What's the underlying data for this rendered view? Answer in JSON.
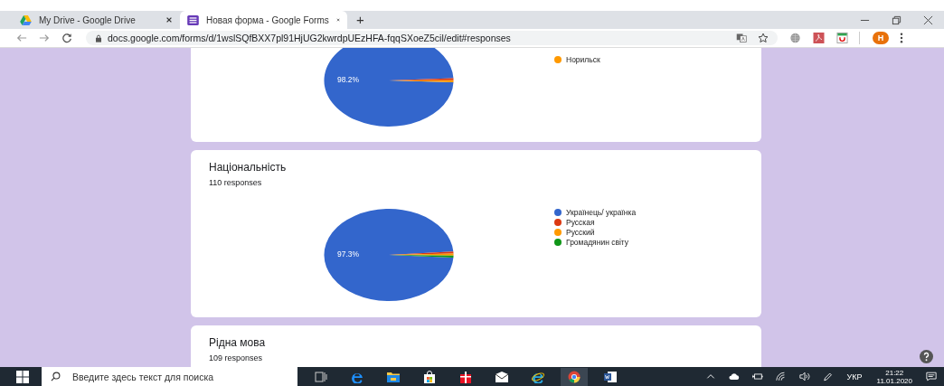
{
  "tabs": [
    {
      "title": "My Drive - Google Drive",
      "selected": false
    },
    {
      "title": "Новая форма - Google Forms",
      "selected": true
    }
  ],
  "new_tab": "+",
  "address_bar": {
    "url": "docs.google.com/forms/d/1wslSQfBXX7pl91HjUG2kwrdpUEzHFA-fqqSXoeZ5cil/edit#responses"
  },
  "profile": {
    "initial": "H"
  },
  "cards": [
    {
      "slices": [
        {
          "color": "#3366cc"
        },
        {
          "color": "#dc3912"
        },
        {
          "color": "#ff9900"
        }
      ],
      "percent_label": "98.2%",
      "legend": [
        {
          "label": "Норильск",
          "color": "#ff9900"
        }
      ]
    },
    {
      "title": "Національність",
      "responses": "110 responses",
      "slices": [
        {
          "color": "#3366cc"
        },
        {
          "color": "#dc3912"
        },
        {
          "color": "#ff9900"
        },
        {
          "color": "#109618"
        }
      ],
      "percent_label": "97.3%",
      "legend": [
        {
          "label": "Українець/ українка",
          "color": "#3366cc"
        },
        {
          "label": "Русская",
          "color": "#dc3912"
        },
        {
          "label": "Русский",
          "color": "#ff9900"
        },
        {
          "label": "Громадянин світу",
          "color": "#109618"
        }
      ]
    },
    {
      "title": "Рідна мова",
      "responses": "109 responses"
    }
  ],
  "taskbar": {
    "search_placeholder": "Введите здесь текст для поиска",
    "language": "УКР",
    "time": "21:22",
    "date": "11.01.2020"
  }
}
